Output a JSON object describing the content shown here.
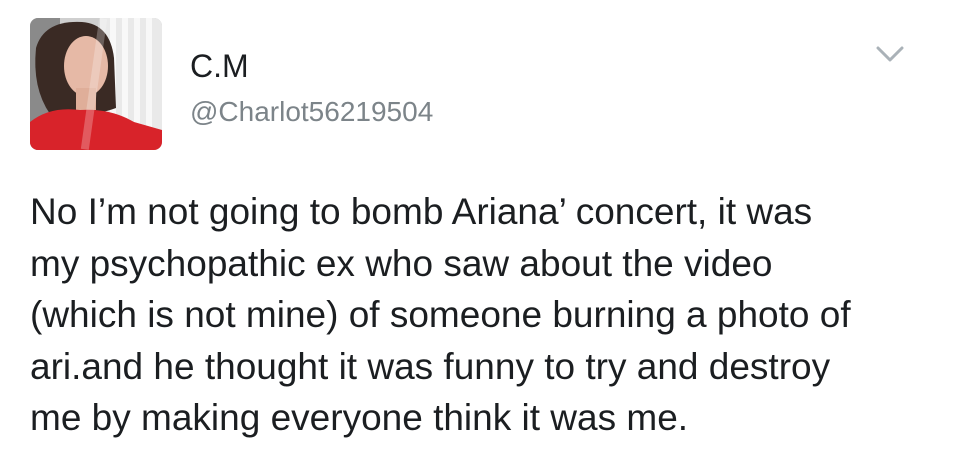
{
  "author": {
    "display_name": "C.M",
    "handle": "@Charlot56219504",
    "avatar_icon": "profile-photo"
  },
  "menu": {
    "icon": "chevron-down-icon"
  },
  "tweet": {
    "lines": [
      "No I’m not going to bomb Ariana’ concert, it was",
      "my psychopathic ex who saw about the video",
      "(which is not mine) of someone burning a photo of",
      "ari.and he thought it was funny to try and destroy",
      "me by making everyone think it was me."
    ]
  },
  "colors": {
    "text": "#1b1e21",
    "handle": "#7c8489",
    "chevron": "#aab2b8",
    "avatar_shirt": "#d8232a"
  }
}
